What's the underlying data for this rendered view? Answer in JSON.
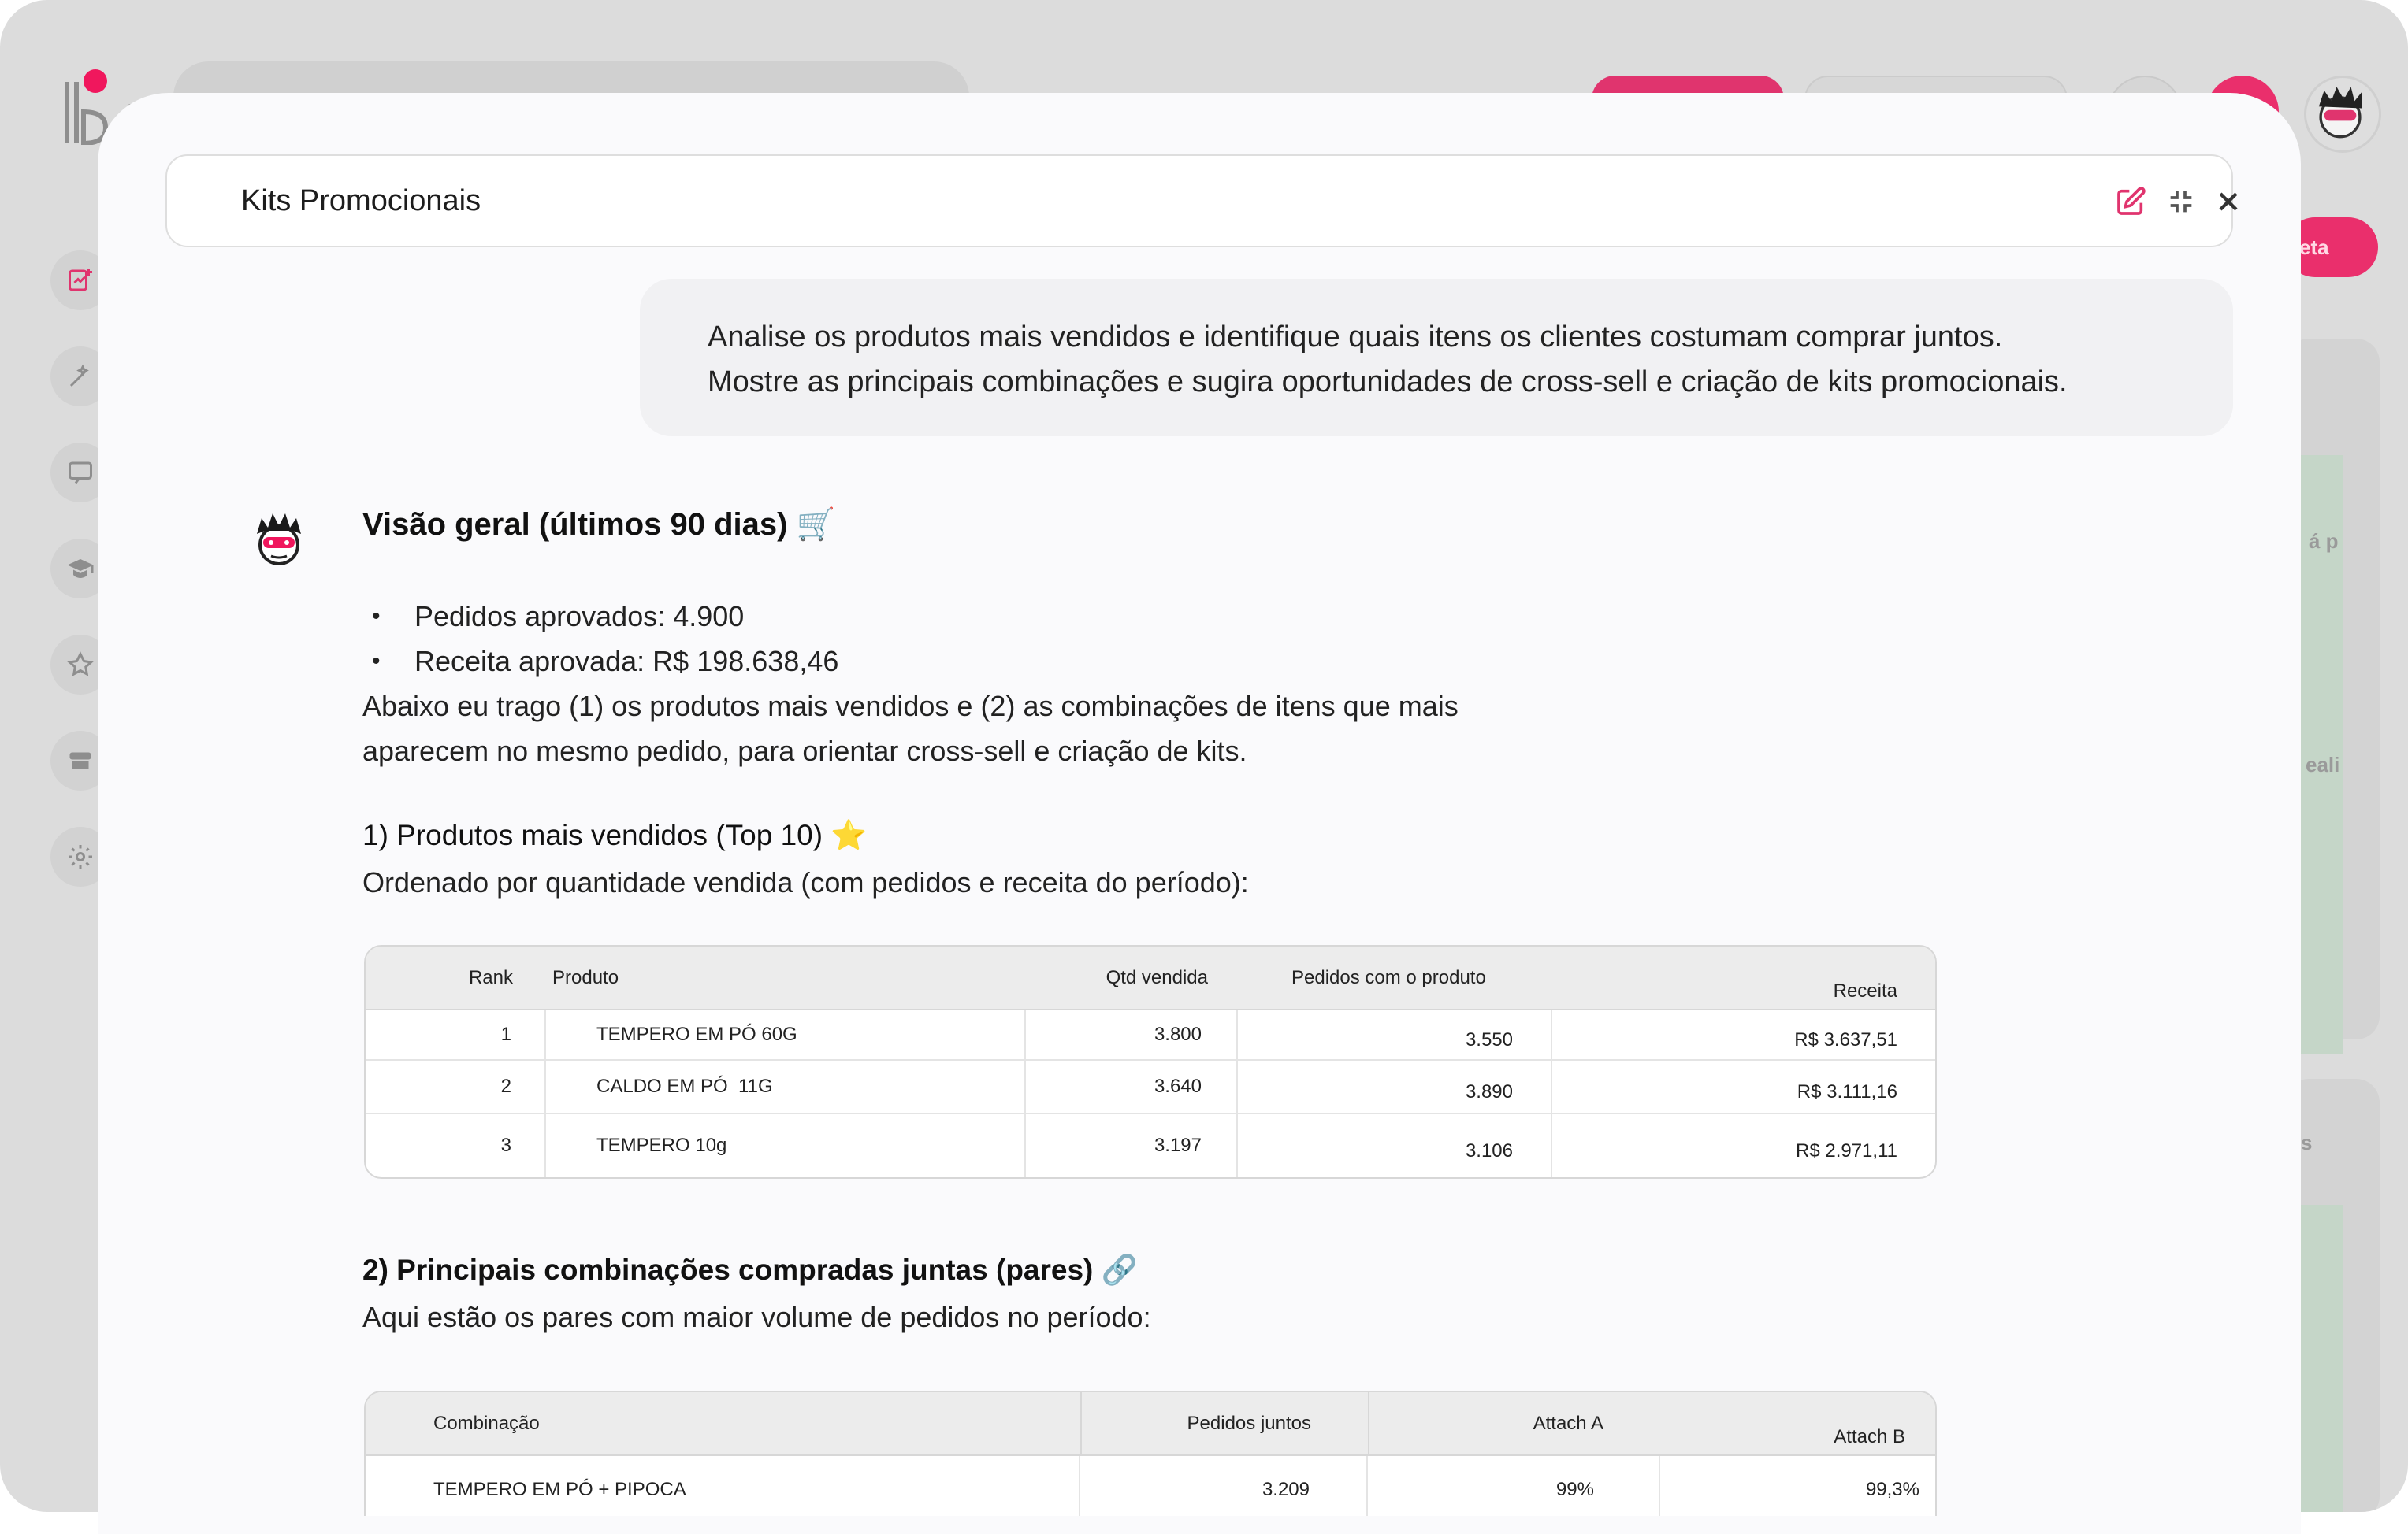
{
  "modal": {
    "title": "Kits Promocionais"
  },
  "user_message": {
    "line1": "Analise os produtos mais vendidos e identifique quais itens os clientes costumam comprar juntos.",
    "line2": "Mostre as principais combinações e sugira oportunidades de cross-sell e criação de kits promocionais."
  },
  "response": {
    "overview_title": "Visão geral (últimos 90 dias)",
    "overview_emoji": "🛒",
    "bullets": [
      "Pedidos aprovados: 4.900",
      "Receita aprovada: R$ 198.638,46"
    ],
    "intro_line1": "Abaixo eu trago (1) os produtos mais vendidos e (2) as combinações de itens que mais",
    "intro_line2": "aparecem no mesmo pedido, para orientar cross-sell e criação de kits.",
    "section1_title": "1) Produtos mais vendidos (Top 10)",
    "section1_emoji": "⭐",
    "section1_desc": "Ordenado por quantidade vendida (com pedidos e receita do período):",
    "table1": {
      "headers": [
        "Rank",
        "Produto",
        "Qtd vendida",
        "Pedidos com o produto",
        "Receita"
      ],
      "rows": [
        [
          "1",
          "TEMPERO EM PÓ 60G",
          "3.800",
          "3.550",
          "R$ 3.637,51"
        ],
        [
          "2",
          "CALDO EM PÓ  11G",
          "3.640",
          "3.890",
          "R$ 3.111,16"
        ],
        [
          "3",
          "TEMPERO 10g",
          "3.197",
          "3.106",
          "R$ 2.971,11"
        ]
      ]
    },
    "section2_title": "2) Principais combinações compradas juntas (pares)",
    "section2_emoji": "🔗",
    "section2_desc": "Aqui estão os pares com maior volume de pedidos no período:",
    "table2": {
      "headers": [
        "Combinação",
        "Pedidos juntos",
        "Attach A",
        "Attach B"
      ],
      "rows": [
        [
          "TEMPERO EM PÓ + PIPOCA",
          "3.209",
          "99%",
          "99,3%"
        ]
      ]
    }
  },
  "background": {
    "meta_button": "eta",
    "text_fragment_1": "á p",
    "text_fragment_2": "eali",
    "text_fragment_3": "s"
  },
  "colors": {
    "accent": "#f0175d",
    "modal_bg": "#fafafc",
    "backdrop": "#dcdcdc"
  }
}
